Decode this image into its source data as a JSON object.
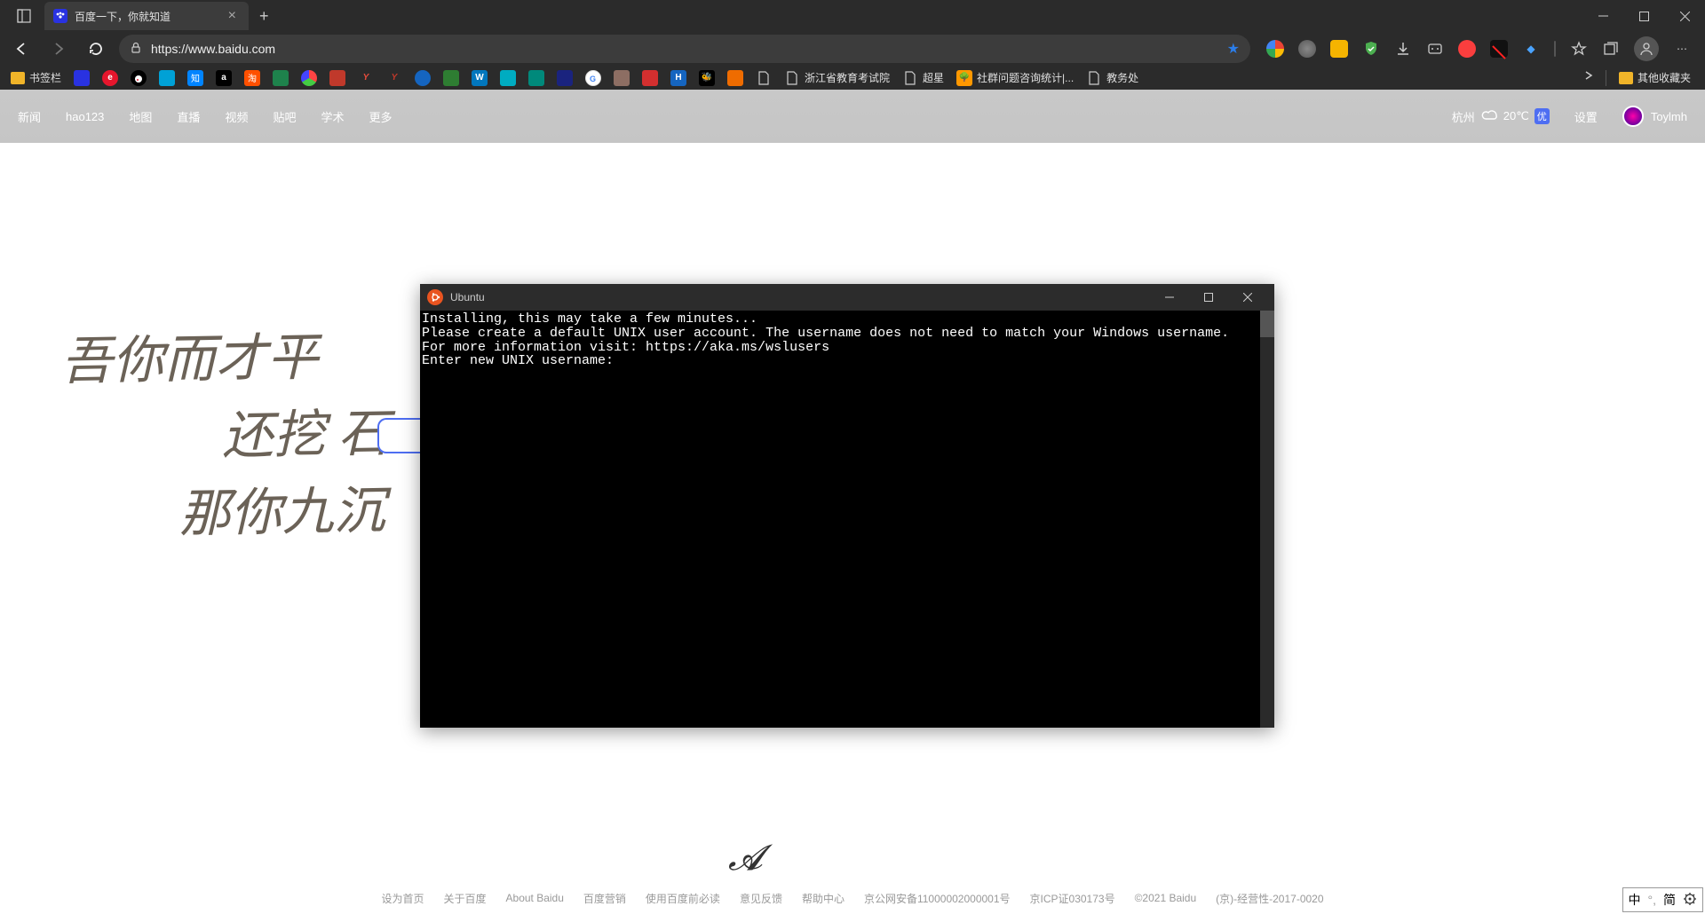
{
  "browser": {
    "tab": {
      "title": "百度一下，你就知道"
    },
    "url": "https://www.baidu.com",
    "bookmarks_label": "书签栏",
    "text_bookmarks": [
      "浙江省教育考试院",
      "超星",
      "社群问题咨询统计|...",
      "教务处"
    ],
    "other_bookmarks": "其他收藏夹"
  },
  "baidu": {
    "nav": [
      "新闻",
      "hao123",
      "地图",
      "直播",
      "视频",
      "贴吧",
      "学术",
      "更多"
    ],
    "weather": {
      "city": "杭州",
      "temp": "20℃",
      "badge": "优"
    },
    "settings": "设置",
    "user": "Toylmh",
    "footer": [
      "设为首页",
      "关于百度",
      "About Baidu",
      "百度营销",
      "使用百度前必读",
      "意见反馈",
      "帮助中心",
      "京公网安备11000002000001号",
      "京ICP证030173号",
      "©2021 Baidu",
      "(京)-经营性-2017-0020"
    ],
    "handwriting": [
      "吾你而才平",
      "还挖 石",
      "那你九沉"
    ]
  },
  "terminal": {
    "title": "Ubuntu",
    "lines": [
      "Installing, this may take a few minutes...",
      "Please create a default UNIX user account. The username does not need to match your Windows username.",
      "For more information visit: https://aka.ms/wslusers",
      "Enter new UNIX username:"
    ]
  },
  "ime": {
    "lang": "中",
    "mode": "简"
  }
}
